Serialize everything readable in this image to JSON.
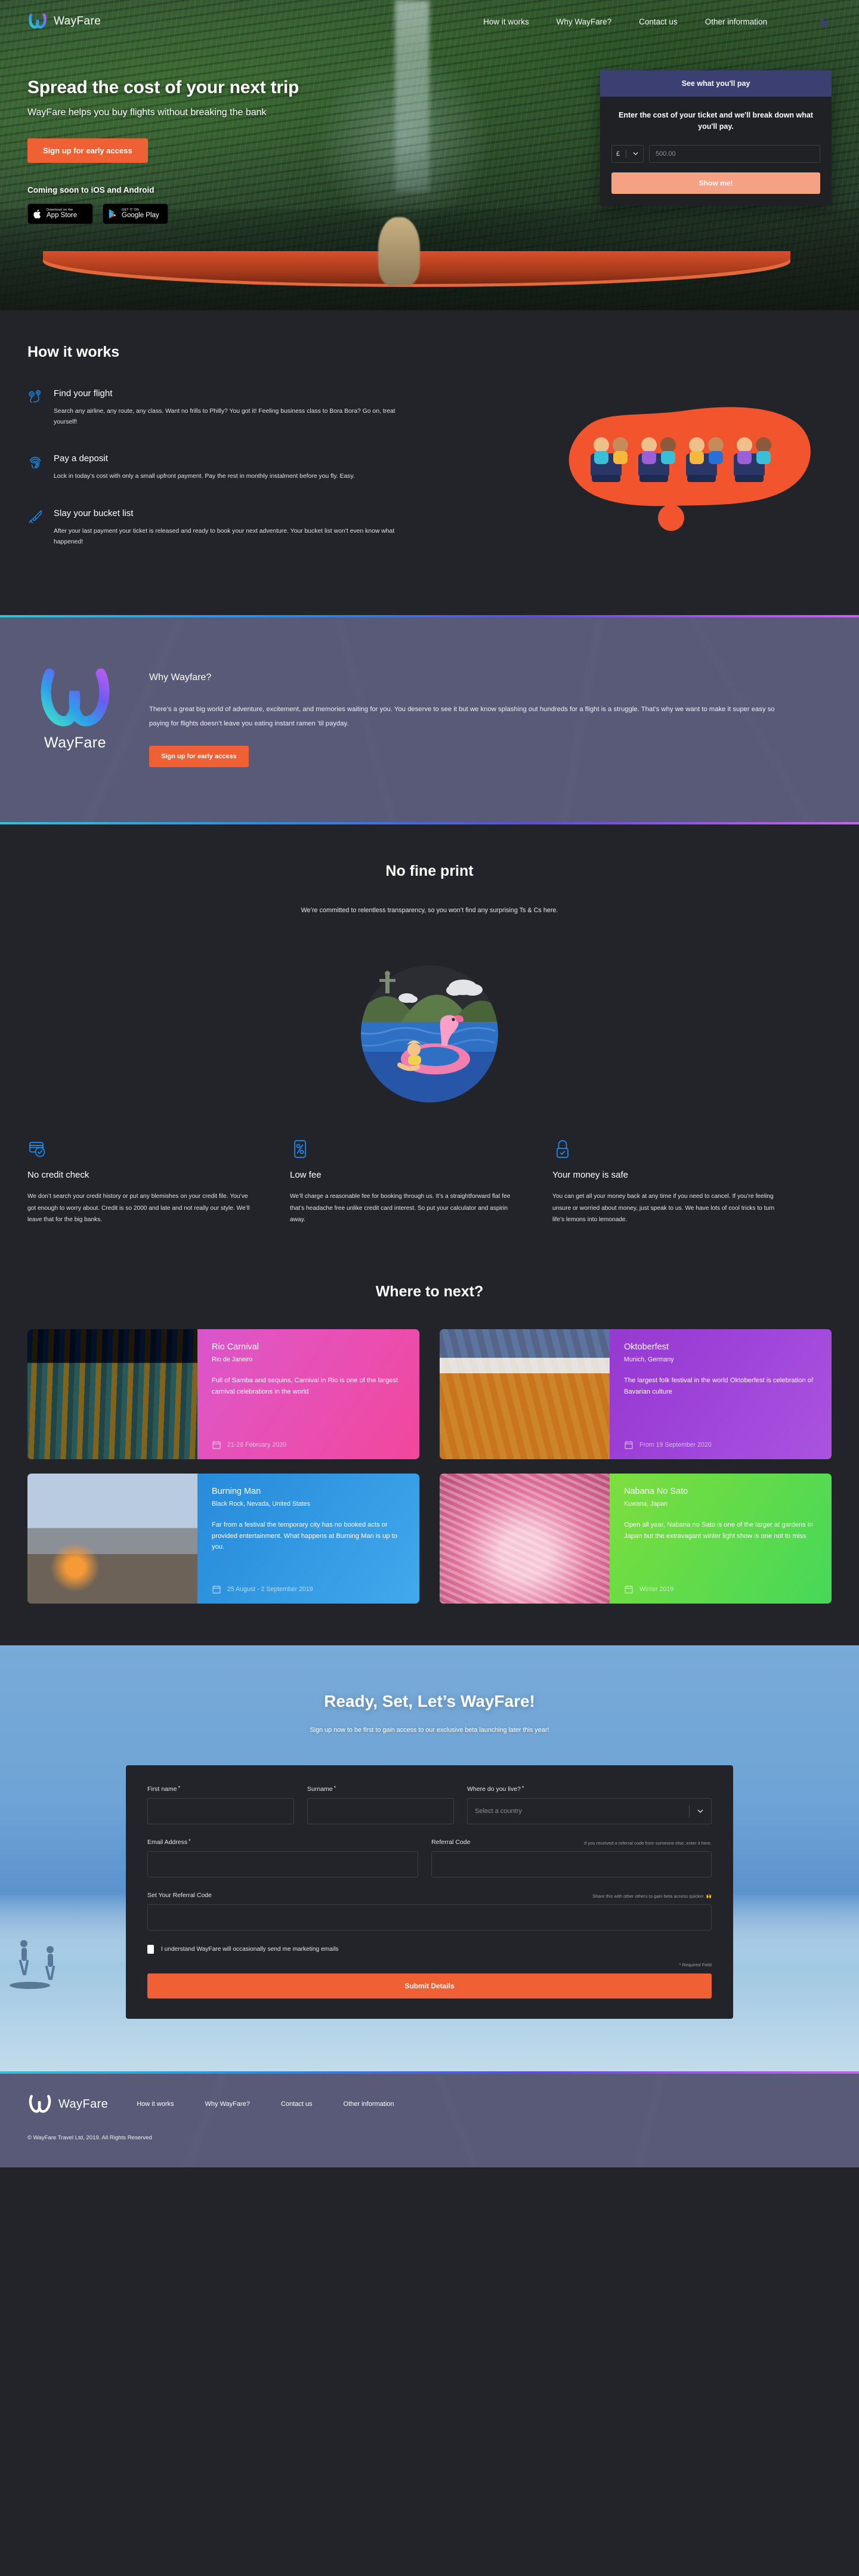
{
  "brand": {
    "name": "WayFare"
  },
  "nav": {
    "links": [
      {
        "label": "How it works"
      },
      {
        "label": "Why WayFare?"
      },
      {
        "label": "Contact us"
      },
      {
        "label": "Other information"
      }
    ],
    "theme_toggle_icon": "moon-icon"
  },
  "hero": {
    "headline": "Spread the cost of your next trip",
    "subhead": "WayFare helps you buy flights without breaking the bank",
    "cta_label": "Sign up for early access",
    "coming_soon": "Coming soon to iOS and Android",
    "app_store": {
      "small": "Download on the",
      "big": "App Store"
    },
    "google_play": {
      "small": "GET IT ON",
      "big": "Google Play"
    }
  },
  "calculator": {
    "header": "See what you'll pay",
    "lead": "Enter the cost of your ticket and we'll break down what you'll pay.",
    "currency_symbol": "£",
    "amount_placeholder": "500.00",
    "submit_label": "Show me!"
  },
  "how_it_works": {
    "title": "How it works",
    "steps": [
      {
        "icon": "map-pin-route-icon",
        "title": "Find your flight",
        "desc": "Search any airline, any route, any class. Want no frills to Philly? You got it! Feeling business class to Bora Bora? Go on, treat yourself!"
      },
      {
        "icon": "fingerprint-icon",
        "title": "Pay a deposit",
        "desc": "Lock in today’s cost with only a small upfront payment. Pay the rest in monthly instalment before you fly. Easy."
      },
      {
        "icon": "sword-icon",
        "title": "Slay your bucket list",
        "desc": "After your last payment your ticket is released and ready to book your next adventure. Your bucket list won’t even know what happened!"
      }
    ]
  },
  "why": {
    "logo_name": "WayFare",
    "heading": "Why Wayfare?",
    "paragraph": "There’s a great big world of adventure, excitement, and memories waiting for you. You deserve to see it but we know splashing out hundreds for a flight is a struggle. That’s why we want to make it super easy so paying for flights doesn’t leave you eating instant ramen ’til payday.",
    "cta_label": "Sign up for early access"
  },
  "fine_print": {
    "title": "No fine print",
    "subtitle": "We’re committed to relentless transparency, so you won’t find any surprising Ts & Cs here.",
    "features": [
      {
        "icon": "credit-card-check-icon",
        "title": "No credit check",
        "desc": "We don’t search your credit history or put any blemishes on your credit file. You’ve got enough to worry about. Credit is so 2000 and late and not really our style. We’ll leave that for the big banks."
      },
      {
        "icon": "percent-icon",
        "title": "Low fee",
        "desc": "We’ll charge a reasonable fee for booking through us. It’s a straightforward flat fee that’s headache free unlike credit card interest. So put your calculator and aspirin away."
      },
      {
        "icon": "lock-check-icon",
        "title": "Your money is safe",
        "desc": "You can get all your money back at any time if you need to cancel. If you’re feeling unsure or worried about money, just speak to us. We have lots of cool tricks to turn life’s lemons into lemonade."
      }
    ]
  },
  "where_to_next": {
    "title": "Where to next?",
    "cards": [
      {
        "name": "Rio Carnival",
        "location": "Rio de Janeiro",
        "desc": "Full of Samba and sequins, Carnival in Rio is one of the largest carnival celebrations in the world",
        "date": "21-26 February 2020",
        "image_class": "img-rio",
        "gradient": "linear-gradient(125deg,#c054ec 0%,#e254c0 50%,#f2479c 100%)"
      },
      {
        "name": "Oktoberfest",
        "location": "Munich, Germany",
        "desc": "The largest folk festival in the world Oktoberfest is celebration of Bavarian culture",
        "date": "From 19 September 2020",
        "image_class": "img-okt",
        "gradient": "linear-gradient(125deg,#8b2fc9 0%,#9b3fd6 55%,#ab53e0 100%)"
      },
      {
        "name": "Burning Man",
        "location": "Black Rock, Nevada, United States",
        "desc": "Far from a festival the temporary city has no booked acts or provided entertainment. What happens at Burning Man is up to you.",
        "date": "25 August - 2 September 2019",
        "image_class": "img-burn",
        "gradient": "linear-gradient(125deg,#1f7fd4 0%,#2e93df 55%,#41a9ec 100%)"
      },
      {
        "name": "Nabana No Sato",
        "location": "Kuwana, Japan",
        "desc": "Open all year, Nabana no Sato is one of the larger at gardens in Japan but the extravagant winter light show is one not to miss",
        "date": "Winter 2019",
        "image_class": "img-nab",
        "gradient": "linear-gradient(125deg,#9fe038 0%,#6cdc44 55%,#46d85a 100%)"
      }
    ]
  },
  "signup": {
    "heading": "Ready, Set, Let’s WayFare!",
    "subheading": "Sign up now to be first to gain access to our exclusive beta launching later this year!",
    "fields": {
      "first_name_label": "First name",
      "surname_label": "Surname",
      "country_label": "Where do you live?",
      "country_placeholder": "Select a country",
      "email_label": "Email Address",
      "referral_label": "Referral Code",
      "referral_hint": "If you received a referral code from someone else, enter it here.",
      "set_referral_label": "Set Your Referral Code",
      "set_referral_hint": "Share this with other others to gain beta access quicker. 🙌",
      "required_marker": "*"
    },
    "consent_label": "I understand WayFare will occasionally send me marketing emails",
    "required_note": "* Required Field",
    "submit_label": "Submit Details"
  },
  "footer": {
    "brand_name": "WayFare",
    "links": [
      {
        "label": "How it works"
      },
      {
        "label": "Why WayFare?"
      },
      {
        "label": "Contact us"
      },
      {
        "label": "Other information"
      }
    ],
    "copyright": "© WayFare Travel Ltd, 2019. All Rights Reserved"
  },
  "colors": {
    "accent_orange": "#ef6134",
    "accent_peach": "#f4a184",
    "dark_bg": "#222429",
    "purple_bg": "#585a78",
    "calc_header": "#3b3f72",
    "icon_blue": "#1b8ef0"
  }
}
